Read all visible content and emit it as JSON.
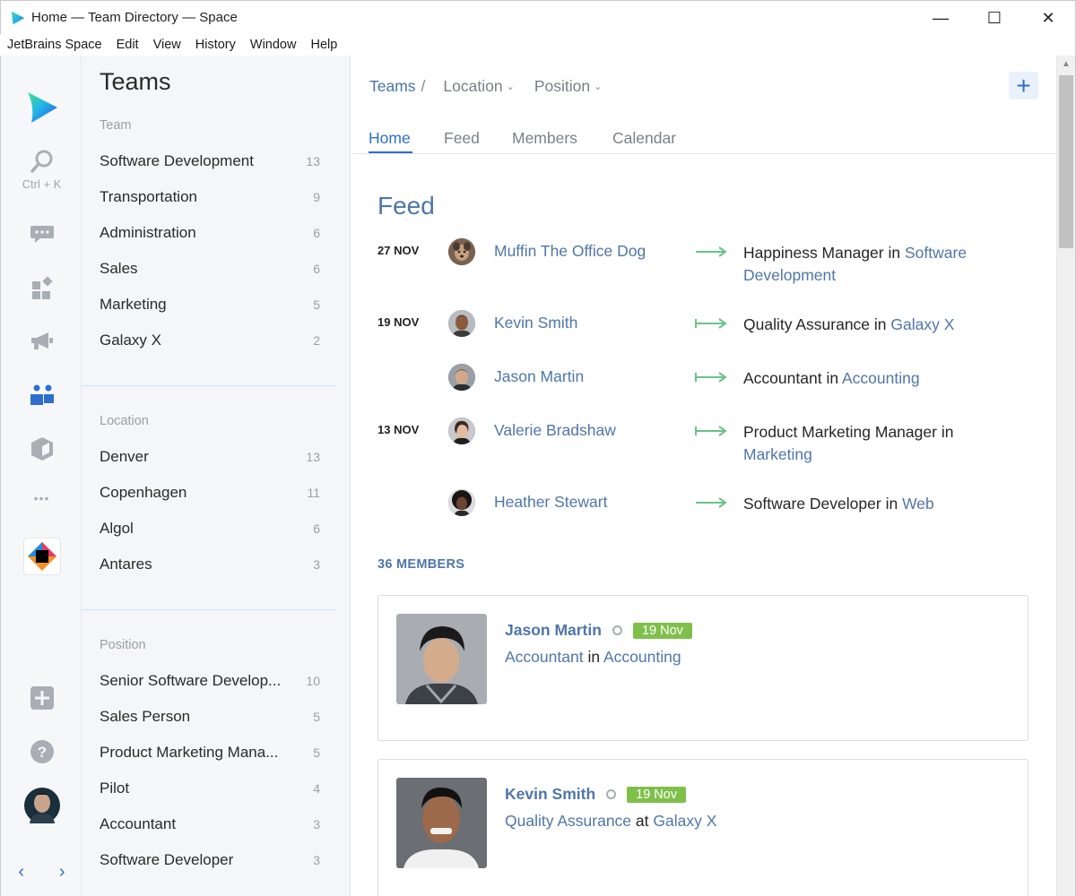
{
  "window": {
    "title": "Home — Team Directory — Space",
    "controls": {
      "minimize": "—",
      "maximize": "☐",
      "close": "✕"
    }
  },
  "menu": [
    "JetBrains Space",
    "Edit",
    "View",
    "History",
    "Window",
    "Help"
  ],
  "rail": {
    "search_shortcut": "Ctrl + K",
    "more": "•••"
  },
  "sidebar": {
    "title": "Teams",
    "team_label": "Team",
    "teams": [
      {
        "label": "Software Development",
        "count": "13"
      },
      {
        "label": "Transportation",
        "count": "9"
      },
      {
        "label": "Administration",
        "count": "6"
      },
      {
        "label": "Sales",
        "count": "6"
      },
      {
        "label": "Marketing",
        "count": "5"
      },
      {
        "label": "Galaxy X",
        "count": "2"
      }
    ],
    "location_label": "Location",
    "locations": [
      {
        "label": "Denver",
        "count": "13"
      },
      {
        "label": "Copenhagen",
        "count": "11"
      },
      {
        "label": "Algol",
        "count": "6"
      },
      {
        "label": "Antares",
        "count": "3"
      }
    ],
    "position_label": "Position",
    "positions": [
      {
        "label": "Senior Software Develop...",
        "count": "10"
      },
      {
        "label": "Sales Person",
        "count": "5"
      },
      {
        "label": "Product Marketing Mana...",
        "count": "5"
      },
      {
        "label": "Pilot",
        "count": "4"
      },
      {
        "label": "Accountant",
        "count": "3"
      },
      {
        "label": "Software Developer",
        "count": "3"
      }
    ]
  },
  "header": {
    "crumb": "Teams",
    "crumb_sep": "/",
    "location_filter": "Location",
    "position_filter": "Position",
    "add_label": "+"
  },
  "tabs": [
    "Home",
    "Feed",
    "Members",
    "Calendar"
  ],
  "feed": {
    "title": "Feed",
    "items": [
      {
        "date": "27 NOV",
        "name": "Muffin The Office Dog",
        "role": "Happiness Manager",
        "prep": "in",
        "team": "Software Development"
      },
      {
        "date": "19 NOV",
        "name": "Kevin Smith",
        "role": "Quality Assurance",
        "prep": "in",
        "team": "Galaxy X"
      },
      {
        "date": "",
        "name": "Jason Martin",
        "role": "Accountant",
        "prep": "in",
        "team": "Accounting"
      },
      {
        "date": "13 NOV",
        "name": "Valerie Bradshaw",
        "role": "Product Marketing Manager",
        "prep": "in",
        "team": "Marketing"
      },
      {
        "date": "",
        "name": "Heather Stewart",
        "role": "Software Developer",
        "prep": "in",
        "team": "Web"
      }
    ]
  },
  "members": {
    "label": "36 MEMBERS",
    "cards": [
      {
        "name": "Jason Martin",
        "badge": "19 Nov",
        "role": "Accountant",
        "prep": "in",
        "team": "Accounting"
      },
      {
        "name": "Kevin Smith",
        "badge": "19 Nov",
        "role": "Quality Assurance",
        "prep": "at",
        "team": "Galaxy X"
      }
    ]
  },
  "colors": {
    "accent": "#2d6fcf",
    "link": "#4f76a9",
    "badge": "#7fc04a",
    "arrow": "#6cc08a"
  }
}
